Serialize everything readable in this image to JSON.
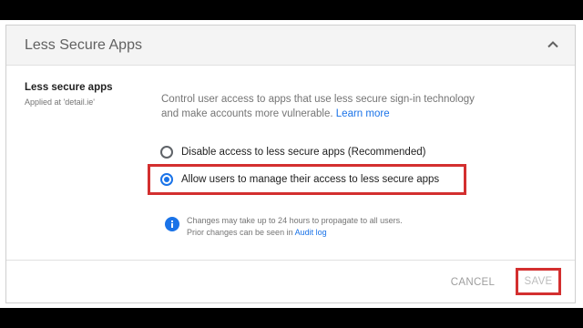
{
  "panel": {
    "title": "Less Secure Apps",
    "collapse_icon": "chevron-up-icon"
  },
  "setting": {
    "name": "Less secure apps",
    "applied_at": "Applied at 'detail.ie'",
    "description": "Control user access to apps that use less secure sign-in technology and make accounts more vulnerable.",
    "learn_more": "Learn more"
  },
  "options": [
    {
      "label": "Disable access to less secure apps (Recommended)",
      "selected": false
    },
    {
      "label": "Allow users to manage their access to less secure apps",
      "selected": true
    }
  ],
  "info": {
    "icon": "info-icon",
    "line1": "Changes may take up to 24 hours to propagate to all users.",
    "line2_prefix": "Prior changes can be seen in",
    "audit_link": "Audit log"
  },
  "footer": {
    "cancel_label": "CANCEL",
    "save_label": "SAVE"
  },
  "colors": {
    "accent": "#1a73e8",
    "highlight": "#d32f2f"
  }
}
